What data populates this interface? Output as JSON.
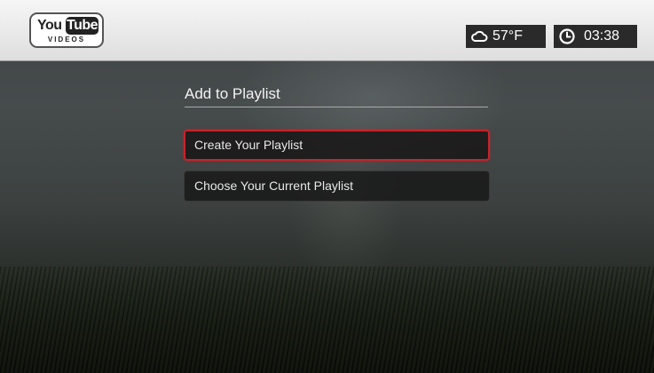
{
  "header": {
    "logo": {
      "you": "You",
      "tube": "Tube",
      "videos": "VIDEOS"
    },
    "weather": {
      "icon": "cloud-icon",
      "temperature": "57°F"
    },
    "clock": {
      "icon": "clock-icon",
      "time": "03:38"
    }
  },
  "dialog": {
    "title": "Add to Playlist",
    "options": [
      {
        "label": "Create Your Playlist",
        "selected": true
      },
      {
        "label": "Choose Your Current Playlist",
        "selected": false
      }
    ]
  },
  "colors": {
    "focus_border": "#c8232b",
    "status_chip": "#2a2a2a",
    "header_bg": "#ececec"
  }
}
